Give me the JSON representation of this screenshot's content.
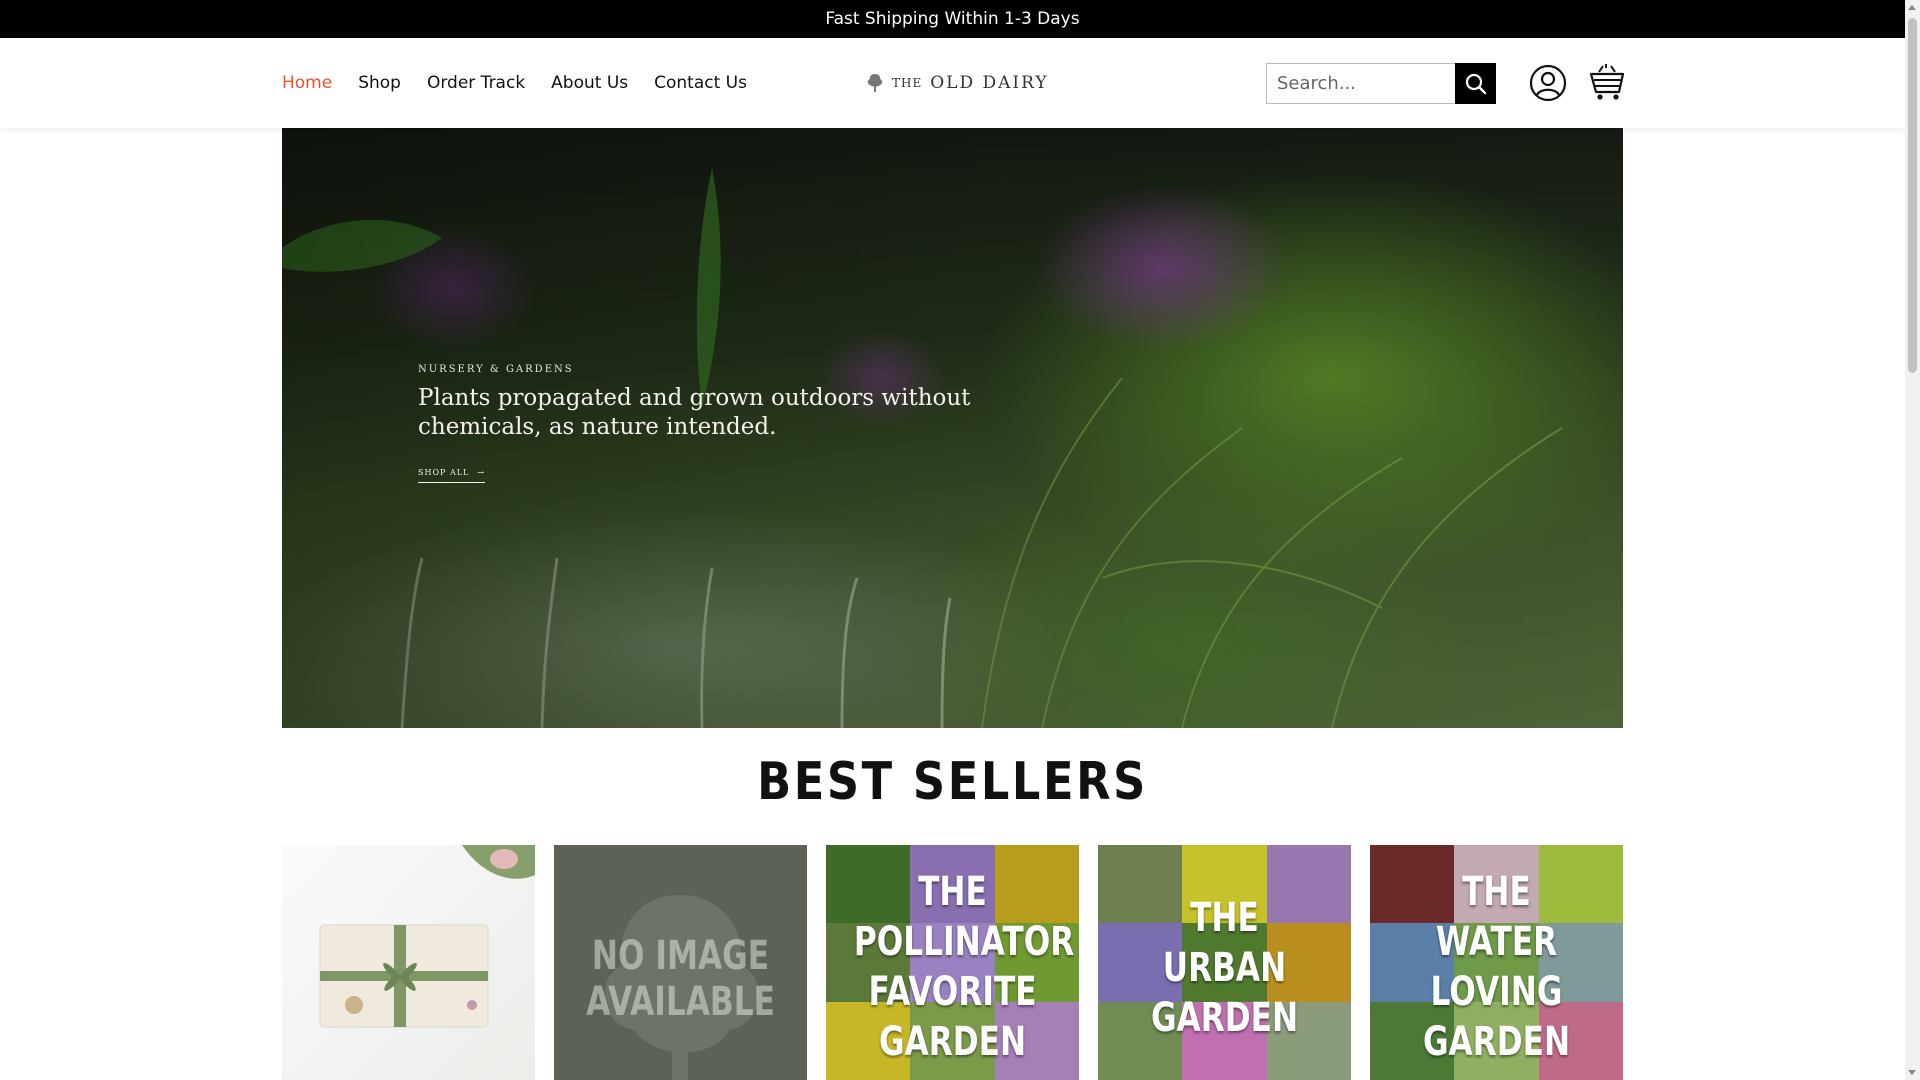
{
  "announcement": "Fast Shipping Within 1-3 Days",
  "nav": {
    "items": [
      {
        "label": "Home",
        "active": true
      },
      {
        "label": "Shop"
      },
      {
        "label": "Order Track"
      },
      {
        "label": "About Us"
      },
      {
        "label": "Contact Us"
      }
    ]
  },
  "logo": {
    "prefix": "THE",
    "name": "OLD DAIRY"
  },
  "search": {
    "placeholder": "Search..."
  },
  "hero": {
    "kicker": "NURSERY & GARDENS",
    "title": "Plants propagated and grown outdoors without chemicals, as nature intended.",
    "link": "SHOP ALL",
    "link_arrow": "→"
  },
  "best_sellers": {
    "title": "BEST SELLERS",
    "products": [
      {
        "image_text": ""
      },
      {
        "image_text": "NO IMAGE AVAILABLE"
      },
      {
        "image_text": "THE POLLINATOR FAVORITE GARDEN"
      },
      {
        "image_text": "THE URBAN GARDEN"
      },
      {
        "image_text": "THE WATER LOVING GARDEN"
      }
    ]
  },
  "colors": {
    "accent": "#e4572e",
    "bar": "#000000"
  },
  "icons": {
    "search": "search-icon",
    "account": "account-icon",
    "cart": "cart-icon",
    "logo": "tree-icon"
  }
}
